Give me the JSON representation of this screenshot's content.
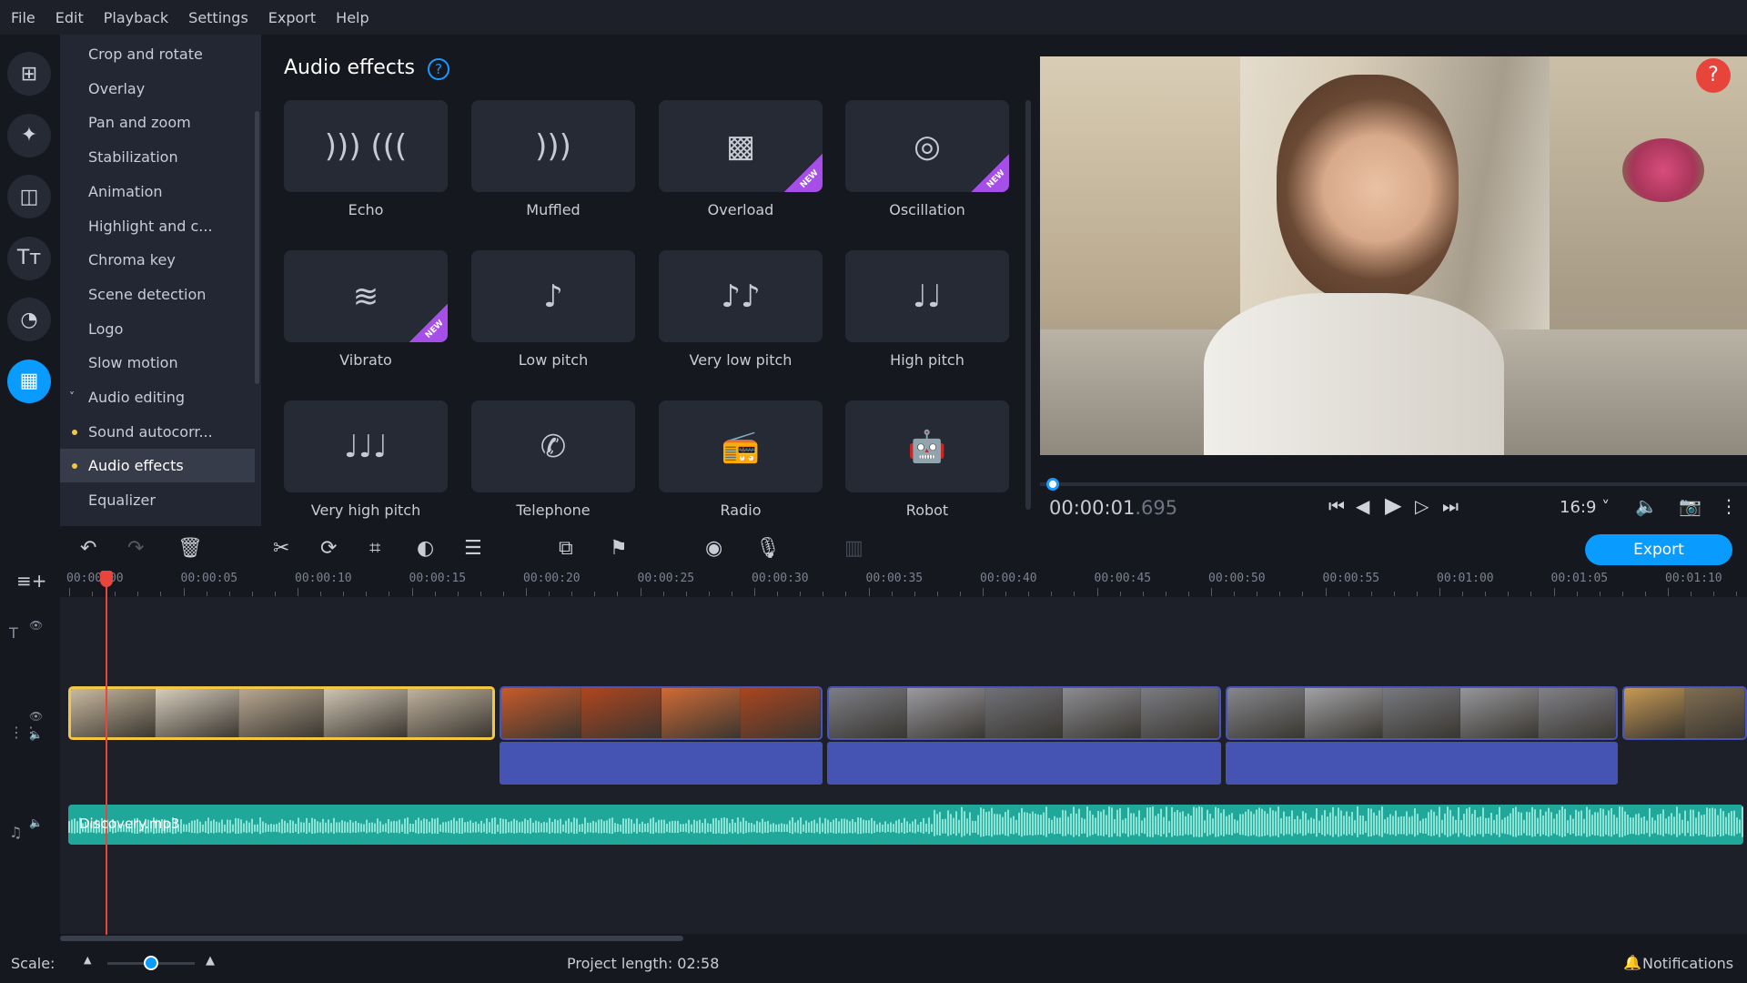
{
  "menu": [
    "File",
    "Edit",
    "Playback",
    "Settings",
    "Export",
    "Help"
  ],
  "rail": [
    {
      "name": "import-icon",
      "glyph": "⊞"
    },
    {
      "name": "magic-wand-icon",
      "glyph": "✦"
    },
    {
      "name": "transitions-icon",
      "glyph": "◫"
    },
    {
      "name": "titles-icon",
      "glyph": "Tт"
    },
    {
      "name": "stickers-icon",
      "glyph": "◔"
    },
    {
      "name": "more-tools-icon",
      "glyph": "▦",
      "active": true
    }
  ],
  "tools_list": [
    {
      "label": "Crop and rotate"
    },
    {
      "label": "Overlay"
    },
    {
      "label": "Pan and zoom"
    },
    {
      "label": "Stabilization"
    },
    {
      "label": "Animation"
    },
    {
      "label": "Highlight and c..."
    },
    {
      "label": "Chroma key"
    },
    {
      "label": "Scene detection"
    },
    {
      "label": "Logo"
    },
    {
      "label": "Slow motion"
    },
    {
      "label": "Audio editing",
      "expanded": true
    },
    {
      "label": "Sound autocorr...",
      "dot": true
    },
    {
      "label": "Audio effects",
      "dot": true,
      "selected": true
    },
    {
      "label": "Equalizer"
    }
  ],
  "panel": {
    "title": "Audio effects",
    "help": "?",
    "new_badge": "NEW",
    "effects": [
      {
        "label": "Echo",
        "icon": "echo-icon",
        "glyph": "))) (((",
        "new": false
      },
      {
        "label": "Muffled",
        "icon": "muffled-icon",
        "glyph": ")))",
        "new": false
      },
      {
        "label": "Overload",
        "icon": "overload-icon",
        "glyph": "▩",
        "new": true
      },
      {
        "label": "Oscillation",
        "icon": "oscillation-icon",
        "glyph": "◎",
        "new": true
      },
      {
        "label": "Vibrato",
        "icon": "vibrato-icon",
        "glyph": "≋",
        "new": true
      },
      {
        "label": "Low pitch",
        "icon": "low-pitch-icon",
        "glyph": "♪",
        "new": false
      },
      {
        "label": "Very low pitch",
        "icon": "very-low-pitch-icon",
        "glyph": "♪♪",
        "new": false
      },
      {
        "label": "High pitch",
        "icon": "high-pitch-icon",
        "glyph": "♩♩",
        "new": false
      },
      {
        "label": "Very high pitch",
        "icon": "very-high-pitch-icon",
        "glyph": "♩♩♩",
        "new": false
      },
      {
        "label": "Telephone",
        "icon": "telephone-icon",
        "glyph": "✆",
        "new": false
      },
      {
        "label": "Radio",
        "icon": "radio-icon",
        "glyph": "📻",
        "new": false
      },
      {
        "label": "Robot",
        "icon": "robot-icon",
        "glyph": "🤖",
        "new": false
      }
    ]
  },
  "player": {
    "help": "?",
    "time_main": "00:00:01",
    "time_ms": ".695",
    "progress": 0.01,
    "aspect": "16:9 ˅"
  },
  "toolbar": {
    "export_label": "Export"
  },
  "ruler": [
    "00:00:00",
    "00:00:05",
    "00:00:10",
    "00:00:15",
    "00:00:20",
    "00:00:25",
    "00:00:30",
    "00:00:35",
    "00:00:40",
    "00:00:45",
    "00:00:50",
    "00:00:55",
    "00:01:00",
    "00:01:05",
    "00:01:10"
  ],
  "audio_track": {
    "file": "Discovery.mp3",
    "color": "#1fa89a"
  },
  "status": {
    "scale_label": "Scale:",
    "scale_value": 0.5,
    "project_length": "Project length: 02:58",
    "notifications": "Notifications"
  },
  "colors": {
    "accent": "#0a9bff",
    "playhead": "#e8453c",
    "selected_clip": "#f2c744",
    "new_badge": "#a64ee8"
  }
}
